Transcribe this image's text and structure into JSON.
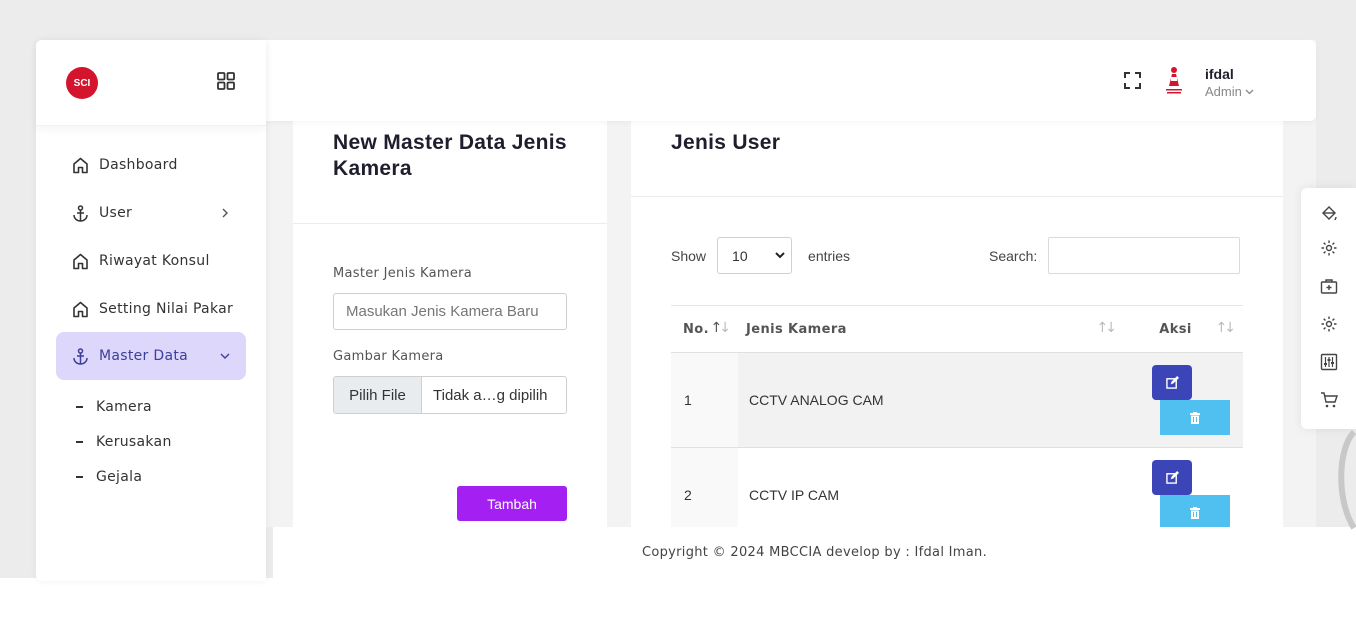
{
  "header": {
    "user_name": "ifdal",
    "user_role": "Admin"
  },
  "sidebar": {
    "logo_text": "SCI",
    "items": [
      {
        "label": "Dashboard",
        "icon": "home-icon"
      },
      {
        "label": "User",
        "icon": "anchor-icon"
      },
      {
        "label": "Riwayat Konsul",
        "icon": "home-icon"
      },
      {
        "label": "Setting Nilai Pakar",
        "icon": "home-icon"
      },
      {
        "label": "Master Data",
        "icon": "anchor-icon",
        "active": true
      }
    ],
    "sub_items": [
      "Kamera",
      "Kerusakan",
      "Gejala"
    ]
  },
  "form_card": {
    "title": "New Master Data Jenis Kamera",
    "field1_label": "Master Jenis Kamera",
    "field1_placeholder": "Masukan Jenis Kamera Baru",
    "field2_label": "Gambar Kamera",
    "file_button": "Pilih File",
    "file_status": "Tidak a…g dipilih",
    "submit_label": "Tambah"
  },
  "table_card": {
    "title": "Jenis User",
    "show_label": "Show",
    "entries_value": "10",
    "entries_label": "entries",
    "search_label": "Search:",
    "columns": [
      "No.",
      "Jenis Kamera",
      "Aksi"
    ],
    "rows": [
      {
        "no": "1",
        "jenis": "CCTV ANALOG CAM"
      },
      {
        "no": "2",
        "jenis": "CCTV IP CAM"
      }
    ]
  },
  "footer": {
    "text": "Copyright © 2024 MBCCIA develop by : Ifdal Iman."
  },
  "colors": {
    "accent_purple": "#a41ff2",
    "edit_blue": "#3b45b8",
    "delete_cyan": "#4fc0ef",
    "active_nav_bg": "#dcd7fb"
  }
}
